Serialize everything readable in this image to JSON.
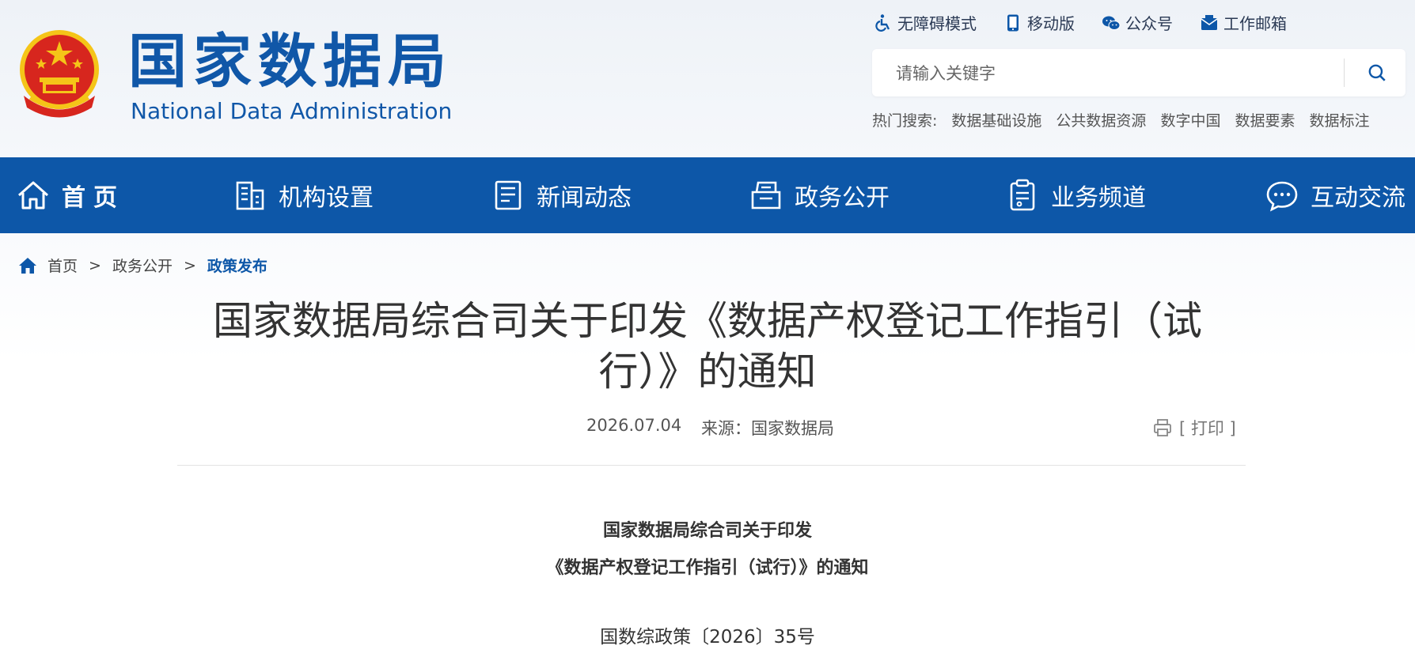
{
  "site": {
    "name_cn": "国家数据局",
    "name_en": "National Data Administration"
  },
  "toplinks": [
    {
      "label": "无障碍模式",
      "icon": "wheelchair-icon"
    },
    {
      "label": "移动版",
      "icon": "mobile-icon"
    },
    {
      "label": "公众号",
      "icon": "wechat-icon"
    },
    {
      "label": "工作邮箱",
      "icon": "mail-icon"
    }
  ],
  "search": {
    "placeholder": "请输入关键字"
  },
  "hot_search": {
    "label": "热门搜索:",
    "items": [
      "数据基础设施",
      "公共数据资源",
      "数字中国",
      "数据要素",
      "数据标注"
    ]
  },
  "nav": [
    {
      "label": "首页",
      "icon": "home-icon"
    },
    {
      "label": "机构设置",
      "icon": "building-icon"
    },
    {
      "label": "新闻动态",
      "icon": "document-icon"
    },
    {
      "label": "政务公开",
      "icon": "folder-icon"
    },
    {
      "label": "业务频道",
      "icon": "clipboard-icon"
    },
    {
      "label": "互动交流",
      "icon": "chat-icon"
    }
  ],
  "breadcrumb": {
    "items": [
      "首页",
      "政务公开",
      "政策发布"
    ],
    "separator": ">"
  },
  "article": {
    "title_line1": "国家数据局综合司关于印发《数据产权登记工作指引（试",
    "title_line2": "行）》的通知",
    "date": "2026.07.04",
    "source": "来源：国家数据局",
    "print_label": "[ 打印 ]",
    "doc_heading_line1": "国家数据局综合司关于印发",
    "doc_heading_line2": "《数据产权登记工作指引（试行）》的通知",
    "doc_number": "国数综政策〔2026〕35号"
  },
  "colors": {
    "brand_blue": "#0d57a8",
    "emblem_red": "#d7261e",
    "emblem_gold": "#f5c518"
  }
}
